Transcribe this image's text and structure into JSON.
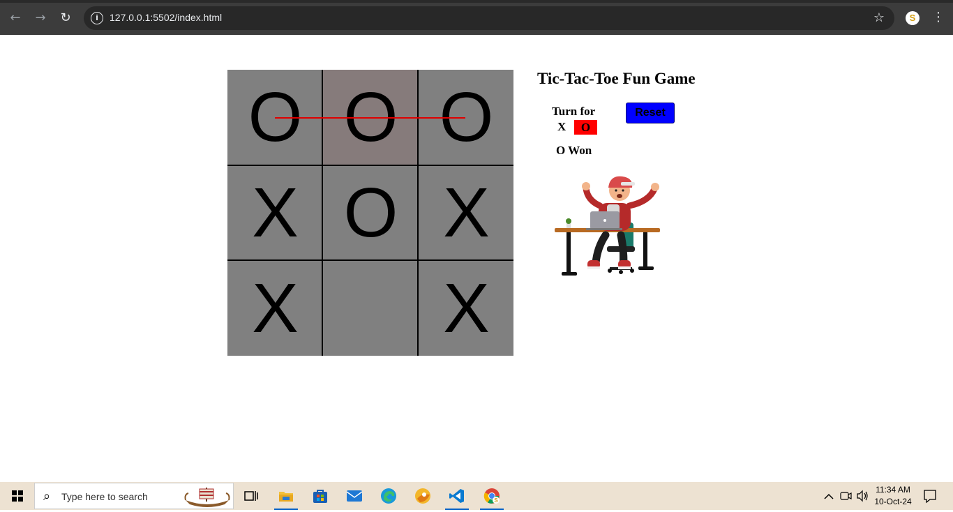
{
  "browser": {
    "url": "127.0.0.1:5502/index.html",
    "back_icon": "←",
    "forward_icon": "→",
    "reload_icon": "↻",
    "info_icon": "i",
    "star_icon": "☆",
    "profile_letter": "S",
    "menu_icon": "⋮"
  },
  "game": {
    "title": "Tic-Tac-Toe Fun Game",
    "turn_label": "Turn for",
    "turn_x": "X",
    "turn_o": "O",
    "reset_label": "Reset",
    "status": "O Won",
    "board": [
      "O",
      "O",
      "O",
      "X",
      "O",
      "X",
      "X",
      "",
      "X"
    ],
    "winning_row": [
      0,
      1,
      2
    ],
    "colors": {
      "board_bg": "#808080",
      "highlight_cell": "#867b7b",
      "win_line": "#e00000",
      "turn_active": "#ff0000",
      "reset_bg": "#0000ff"
    }
  },
  "taskbar": {
    "search_placeholder": "Type here to search",
    "clock_time": "11:34 AM",
    "clock_date": "10-Oct-24",
    "apps": [
      "task-view",
      "file-explorer",
      "microsoft-store",
      "mail",
      "edge",
      "canary-browser",
      "vs-code",
      "chrome"
    ]
  }
}
